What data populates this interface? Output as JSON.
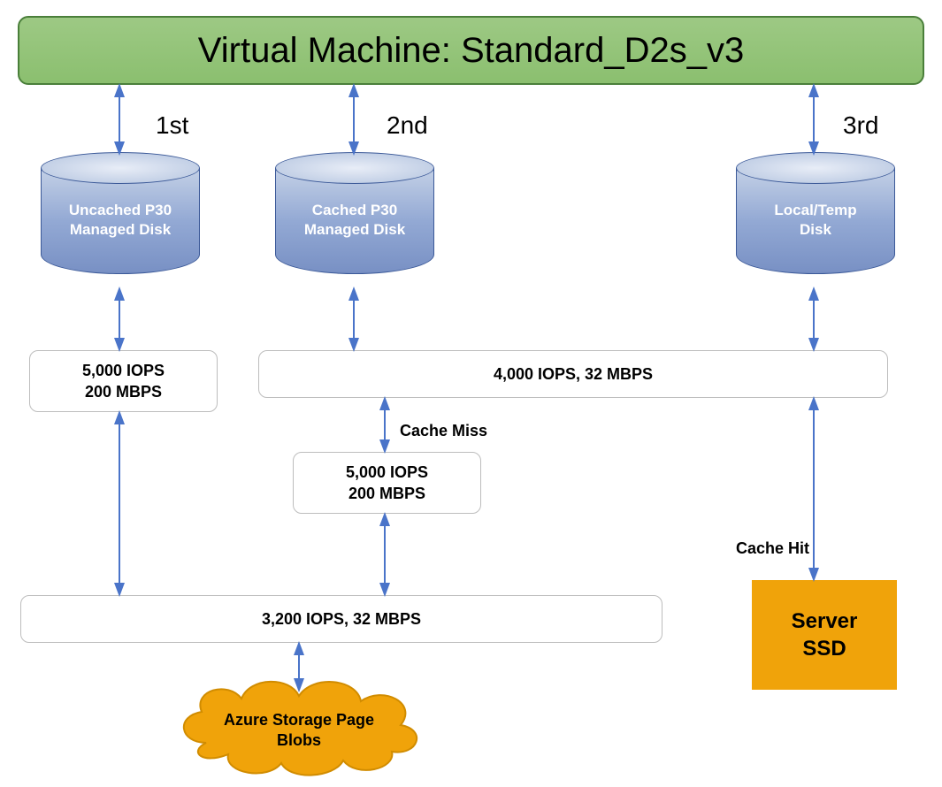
{
  "vm_title": "Virtual Machine: Standard_D2s_v3",
  "ordinals": {
    "first": "1st",
    "second": "2nd",
    "third": "3rd"
  },
  "disks": {
    "uncached": {
      "line1": "Uncached P30",
      "line2": "Managed Disk"
    },
    "cached": {
      "line1": "Cached P30",
      "line2": "Managed Disk"
    },
    "local": {
      "line1": "Local/Temp",
      "line2": "Disk"
    }
  },
  "stats": {
    "uncached_limit": {
      "line1": "5,000 IOPS",
      "line2": "200 MBPS"
    },
    "cached_limit": {
      "text": "4,000 IOPS, 32 MBPS"
    },
    "cache_miss_box": {
      "line1": "5,000 IOPS",
      "line2": "200 MBPS"
    },
    "blob_limit": {
      "text": "3,200 IOPS, 32 MBPS"
    }
  },
  "labels": {
    "cache_miss": "Cache Miss",
    "cache_hit": "Cache Hit"
  },
  "ssd": {
    "line1": "Server",
    "line2": "SSD"
  },
  "cloud": {
    "line1": "Azure Storage Page",
    "line2": "Blobs"
  },
  "colors": {
    "arrow": "#4a74c9",
    "cloud_fill": "#f0a30a",
    "cloud_stroke": "#d18c00"
  }
}
